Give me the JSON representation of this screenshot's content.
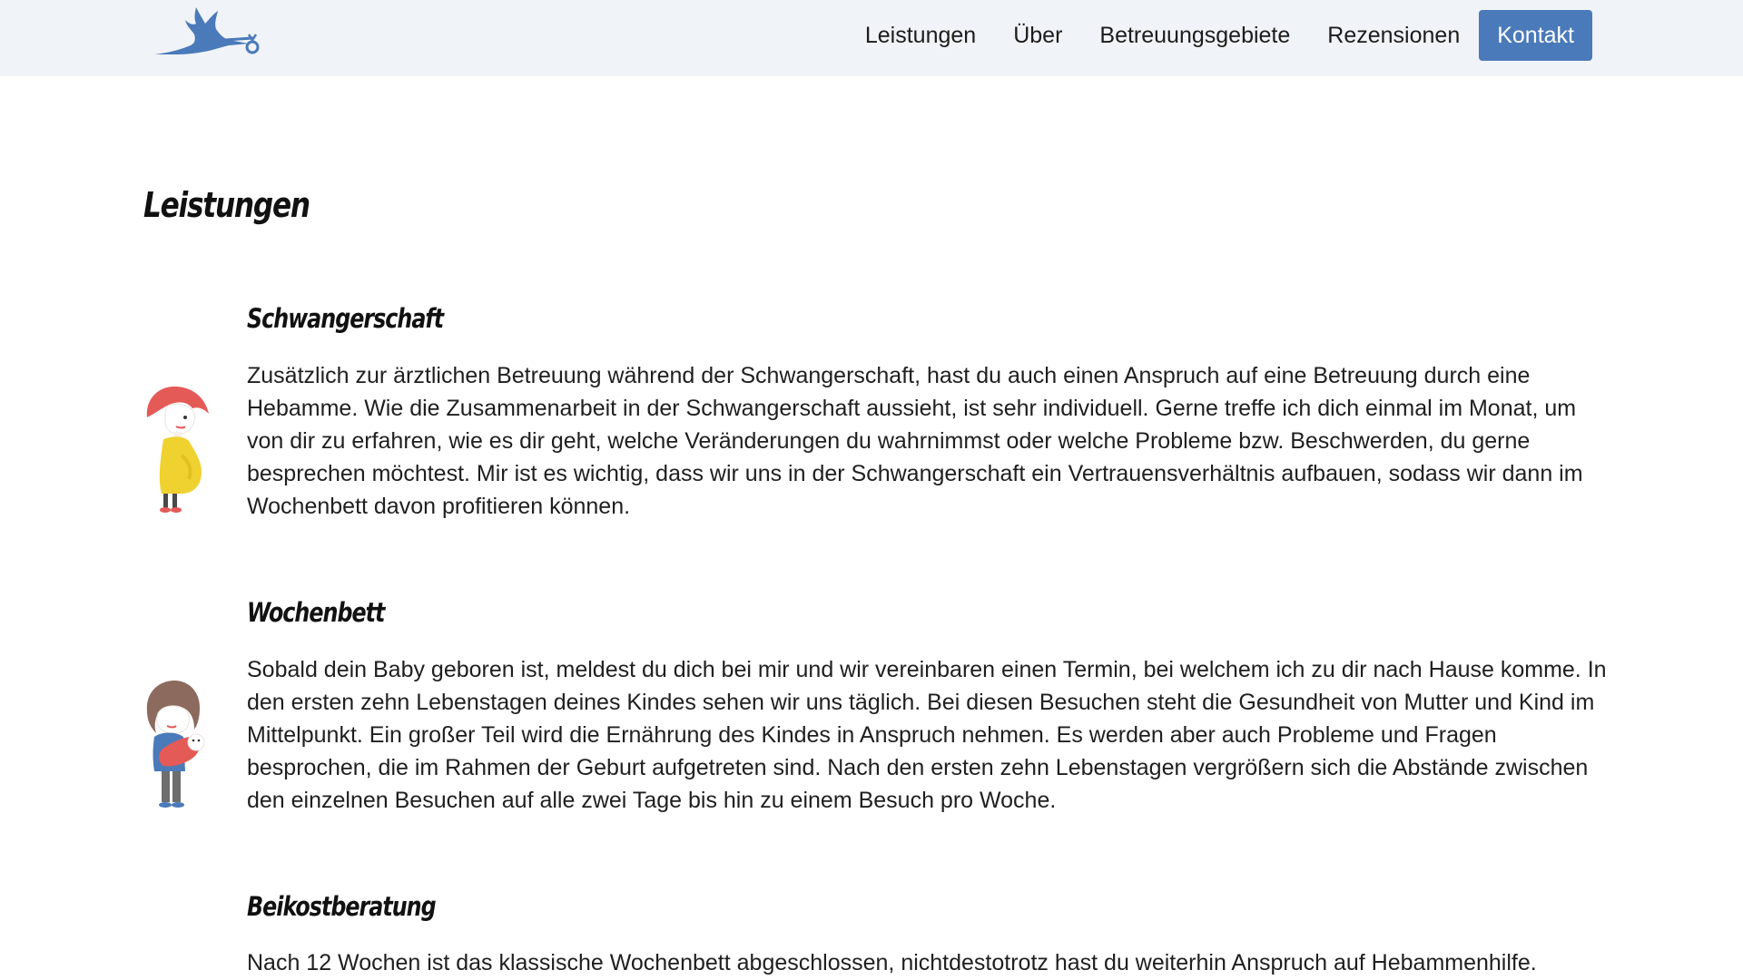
{
  "nav": {
    "logo_icon": "stork-carrying-baby-icon",
    "items": [
      "Leistungen",
      "Über",
      "Betreuungsgebiete",
      "Rezensionen"
    ],
    "contact_button": "Kontakt",
    "accent_color": "#4a7ab9",
    "background_color": "#f0f3f7"
  },
  "page": {
    "title": "Leistungen"
  },
  "services": [
    {
      "icon": "pregnant-woman-icon",
      "heading": "Schwangerschaft",
      "text": "Zusätzlich zur ärztlichen Betreuung während der Schwangerschaft, hast du auch einen Anspruch auf eine Betreuung durch eine Hebamme. Wie die Zusammenarbeit in der Schwangerschaft aussieht, ist sehr individuell. Gerne treffe ich dich einmal im Monat, um von dir zu erfahren, wie es dir geht, welche Veränderungen du wahrnimmst oder welche Probleme bzw. Beschwerden, du gerne besprechen möchtest. Mir ist es wichtig, dass wir uns in der Schwangerschaft ein Vertrauensverhältnis aufbauen, sodass wir dann im Wochenbett davon profitieren können."
    },
    {
      "icon": "mother-with-baby-icon",
      "heading": "Wochenbett",
      "text": "Sobald dein Baby geboren ist, meldest du dich bei mir und wir vereinbaren einen Termin, bei welchem ich zu dir nach Hause komme. In den ersten zehn Lebenstagen deines Kindes sehen wir uns täglich. Bei diesen Besuchen steht die Gesundheit von Mutter und Kind im Mittelpunkt. Ein großer Teil wird die Ernährung des Kindes in Anspruch nehmen. Es werden aber auch Probleme und Fragen besprochen, die im Rahmen der Geburt aufgetreten sind. Nach den ersten zehn Lebenstagen vergrößern sich die Abstände zwischen den einzelnen Besuchen auf alle zwei Tage bis hin zu einem Besuch pro Woche."
    },
    {
      "heading": "Beikostberatung",
      "text": "Nach 12 Wochen ist das klassische Wochenbett abgeschlossen, nichtdestotrotz hast du weiterhin Anspruch auf Hebammenhilfe."
    }
  ]
}
